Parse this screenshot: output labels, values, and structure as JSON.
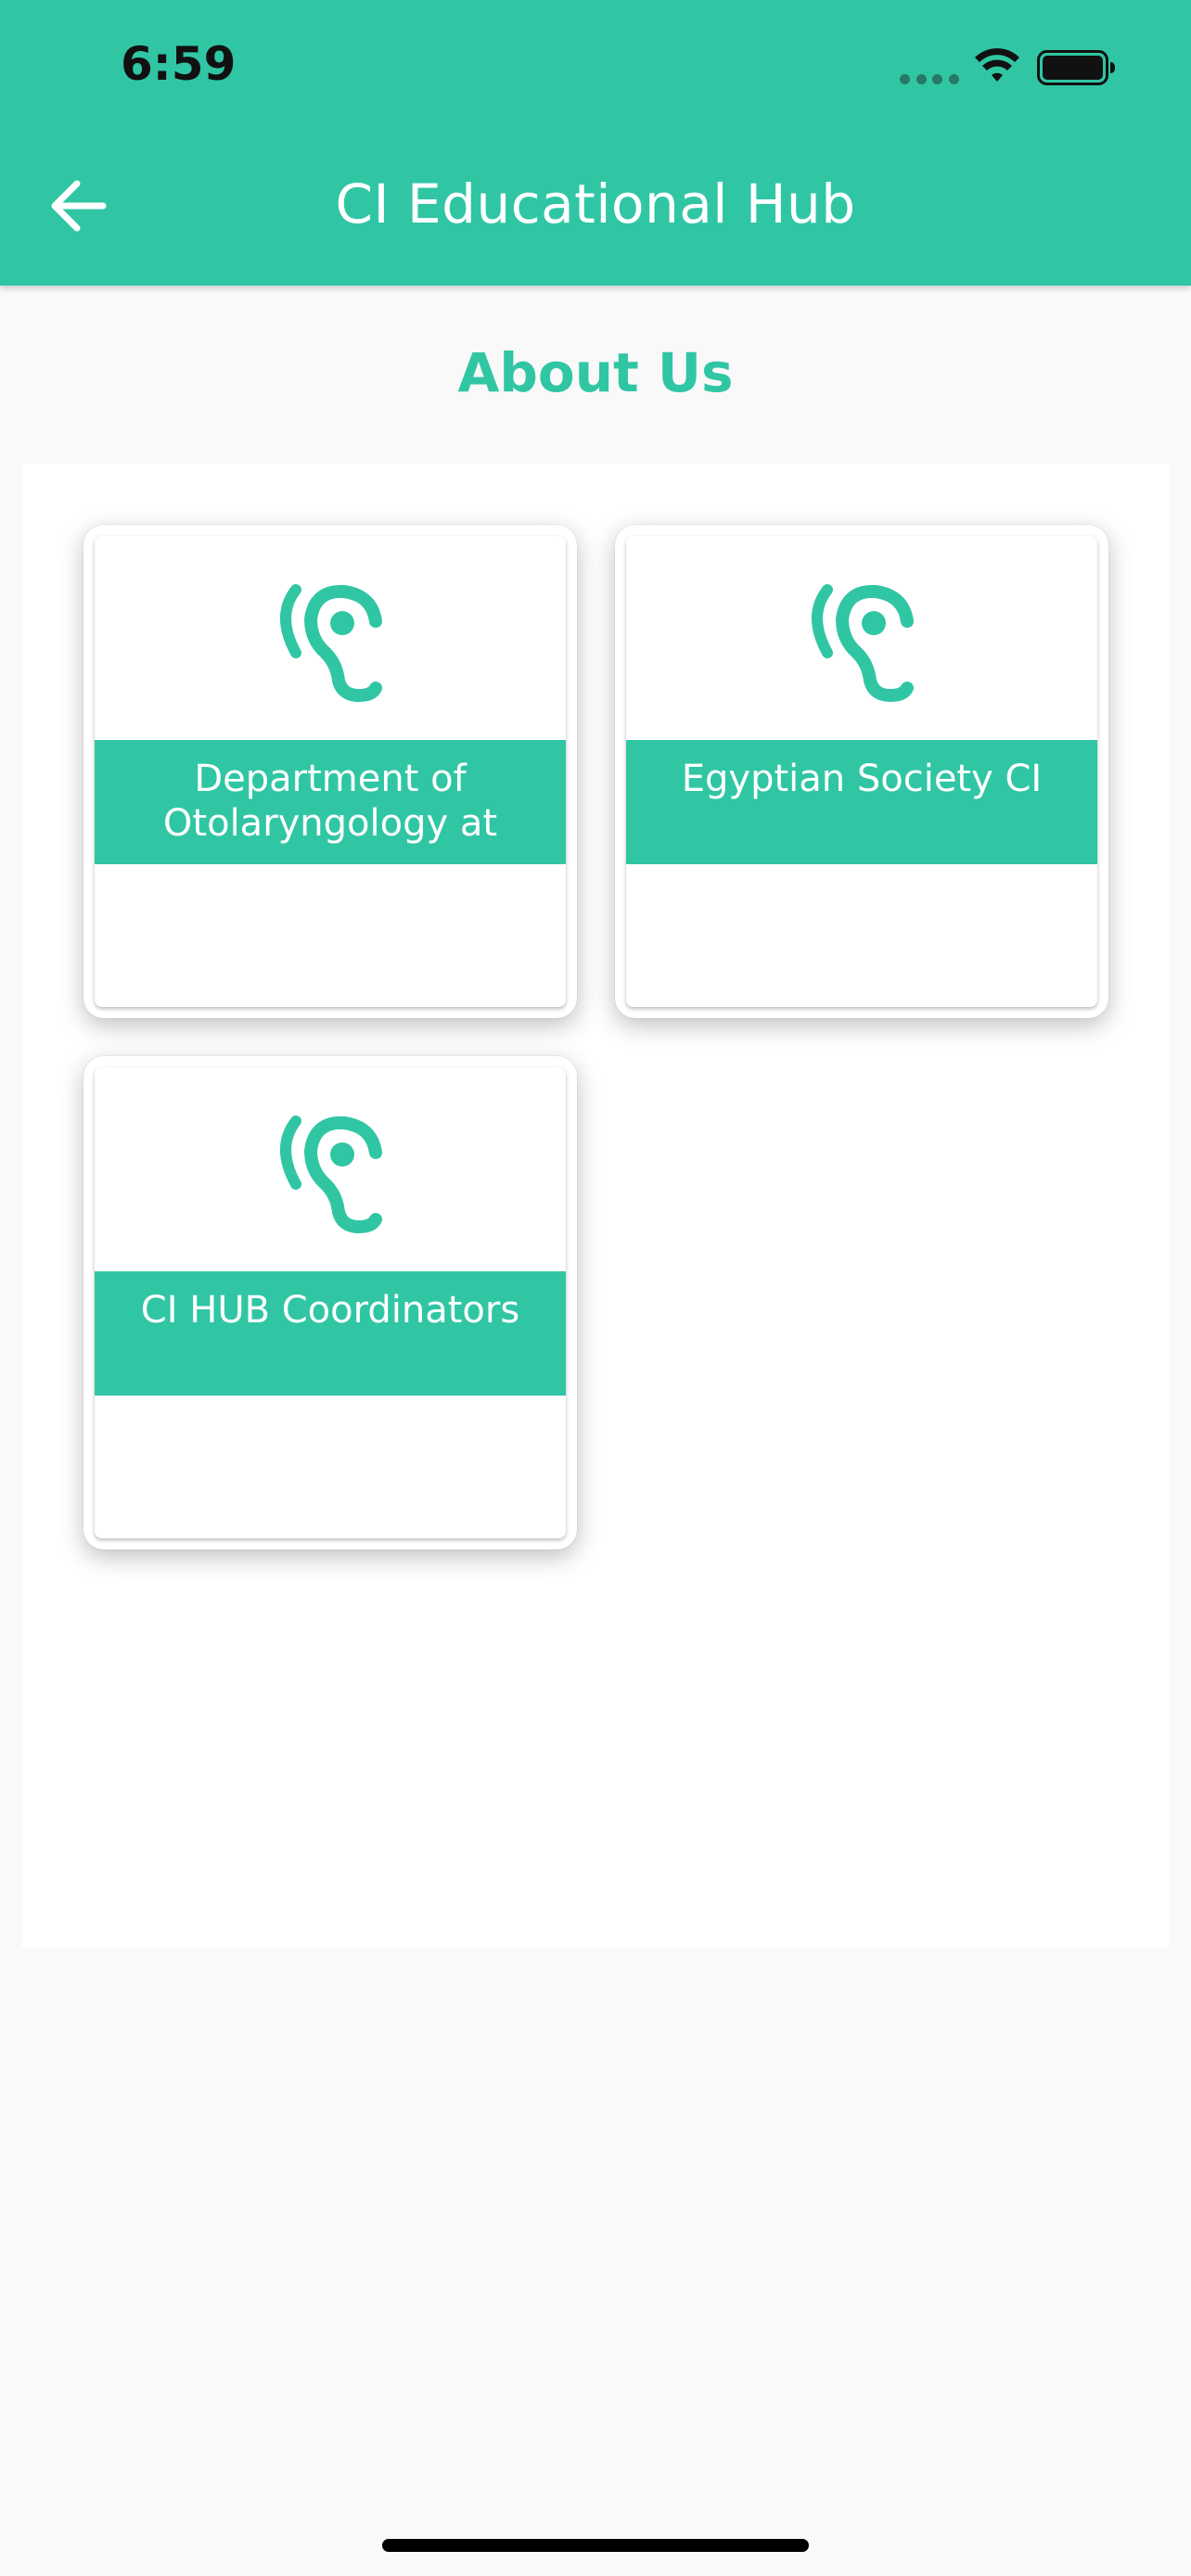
{
  "status_bar": {
    "time": "6:59"
  },
  "header": {
    "title": "CI Educational Hub",
    "back_icon": "arrow-left-icon"
  },
  "page": {
    "section_title": "About Us"
  },
  "cards": [
    {
      "label": "Department of Otolaryngology at",
      "icon": "ear-icon"
    },
    {
      "label": "Egyptian Society CI",
      "icon": "ear-icon"
    },
    {
      "label": "CI HUB Coordinators",
      "icon": "ear-icon"
    }
  ],
  "colors": {
    "accent": "#30c6a4",
    "background": "#f9f9f9",
    "surface": "#ffffff"
  }
}
